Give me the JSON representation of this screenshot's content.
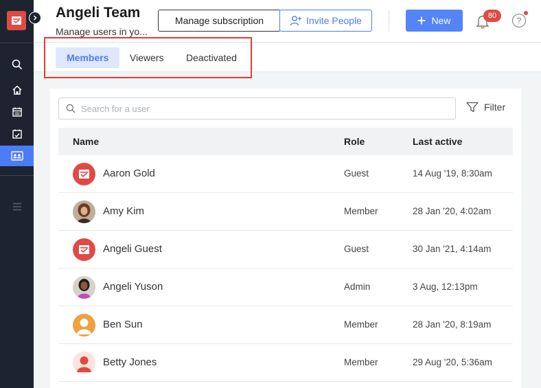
{
  "header": {
    "title": "Angeli Team",
    "subtitle": "Manage users in yo...",
    "manage_label": "Manage subscription",
    "invite_label": "Invite People",
    "new_label": "New",
    "notification_count": "80",
    "help_label": "?"
  },
  "tabs": [
    {
      "label": "Members",
      "active": true
    },
    {
      "label": "Viewers",
      "active": false
    },
    {
      "label": "Deactivated",
      "active": false
    }
  ],
  "search": {
    "placeholder": "Search for a user",
    "value": ""
  },
  "filter_label": "Filter",
  "table": {
    "columns": [
      "Name",
      "Role",
      "Last active"
    ],
    "rows": [
      {
        "name": "Aaron Gold",
        "role": "Guest",
        "last_active": "14 Aug '19, 8:30am",
        "avatar": "app-logo"
      },
      {
        "name": "Amy Kim",
        "role": "Member",
        "last_active": "28 Jan '20, 4:02am",
        "avatar": "photo"
      },
      {
        "name": "Angeli Guest",
        "role": "Guest",
        "last_active": "30 Jan '21, 4:14am",
        "avatar": "app-logo"
      },
      {
        "name": "Angeli Yuson",
        "role": "Admin",
        "last_active": "3 Aug, 12:13pm",
        "avatar": "photo"
      },
      {
        "name": "Ben Sun",
        "role": "Member",
        "last_active": "28 Jan '20, 8:19am",
        "avatar": "person-orange"
      },
      {
        "name": "Betty Jones",
        "role": "Member",
        "last_active": "29 Aug '20, 5:36am",
        "avatar": "person-red"
      }
    ]
  },
  "colors": {
    "accent": "#4b7bf5",
    "brand_red": "#e04a45",
    "sidebar_bg": "#1d2430"
  }
}
